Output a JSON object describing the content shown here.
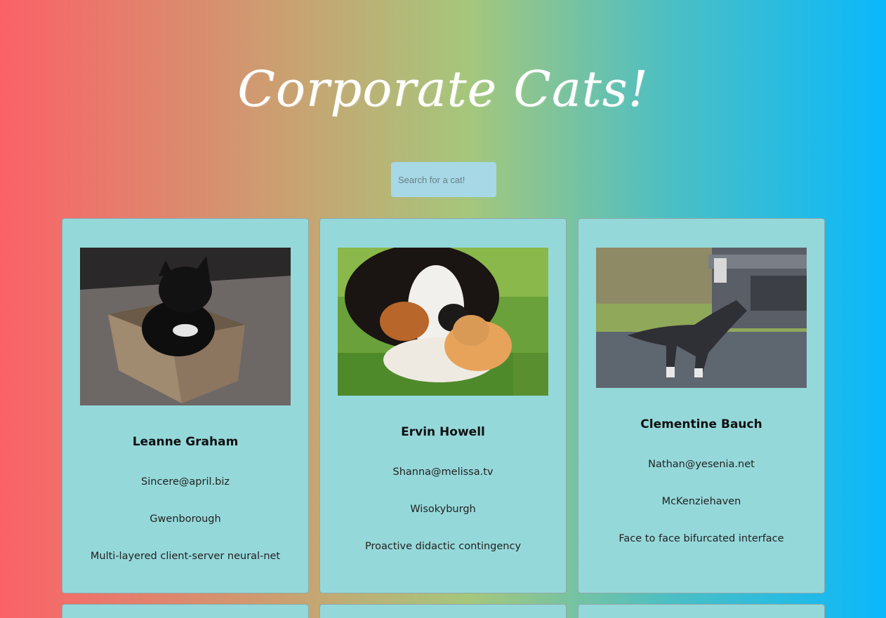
{
  "header": {
    "title": "Corporate Cats!"
  },
  "search": {
    "placeholder": "Search for a cat!"
  },
  "cards": [
    {
      "name": "Leanne Graham",
      "email": "Sincere@april.biz",
      "city": "Gwenborough",
      "catchphrase": "Multi-layered client-server neural-net"
    },
    {
      "name": "Ervin Howell",
      "email": "Shanna@melissa.tv",
      "city": "Wisokyburgh",
      "catchphrase": "Proactive didactic contingency"
    },
    {
      "name": "Clementine Bauch",
      "email": "Nathan@yesenia.net",
      "city": "McKenziehaven",
      "catchphrase": "Face to face bifurcated interface"
    }
  ],
  "colors": {
    "gradient_left": "#fb6168",
    "gradient_right": "#0ab8fb",
    "card_background": "#95d8da",
    "search_background": "#a6d8e6"
  }
}
